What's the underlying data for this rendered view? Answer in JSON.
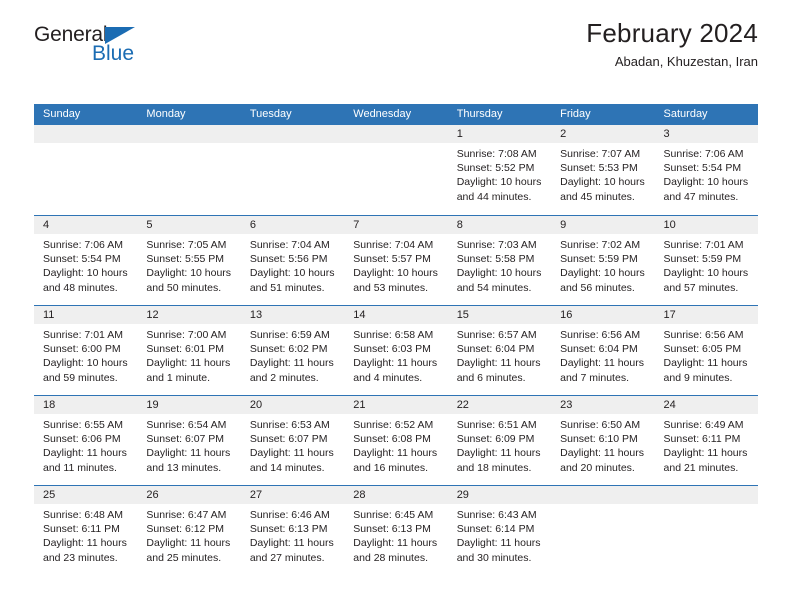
{
  "logo": {
    "text_top": "General",
    "text_bottom": "Blue",
    "triangle_color": "#1b6cb3"
  },
  "header": {
    "title": "February 2024",
    "subtitle": "Abadan, Khuzestan, Iran"
  },
  "colors": {
    "header_bar": "#2e74b5",
    "date_band": "#efefef",
    "text": "#231f20"
  },
  "weekdays": [
    "Sunday",
    "Monday",
    "Tuesday",
    "Wednesday",
    "Thursday",
    "Friday",
    "Saturday"
  ],
  "weeks": [
    [
      {
        "empty": true
      },
      {
        "empty": true
      },
      {
        "empty": true
      },
      {
        "empty": true
      },
      {
        "day": "1",
        "sunrise": "Sunrise: 7:08 AM",
        "sunset": "Sunset: 5:52 PM",
        "daylight1": "Daylight: 10 hours",
        "daylight2": "and 44 minutes."
      },
      {
        "day": "2",
        "sunrise": "Sunrise: 7:07 AM",
        "sunset": "Sunset: 5:53 PM",
        "daylight1": "Daylight: 10 hours",
        "daylight2": "and 45 minutes."
      },
      {
        "day": "3",
        "sunrise": "Sunrise: 7:06 AM",
        "sunset": "Sunset: 5:54 PM",
        "daylight1": "Daylight: 10 hours",
        "daylight2": "and 47 minutes."
      }
    ],
    [
      {
        "day": "4",
        "sunrise": "Sunrise: 7:06 AM",
        "sunset": "Sunset: 5:54 PM",
        "daylight1": "Daylight: 10 hours",
        "daylight2": "and 48 minutes."
      },
      {
        "day": "5",
        "sunrise": "Sunrise: 7:05 AM",
        "sunset": "Sunset: 5:55 PM",
        "daylight1": "Daylight: 10 hours",
        "daylight2": "and 50 minutes."
      },
      {
        "day": "6",
        "sunrise": "Sunrise: 7:04 AM",
        "sunset": "Sunset: 5:56 PM",
        "daylight1": "Daylight: 10 hours",
        "daylight2": "and 51 minutes."
      },
      {
        "day": "7",
        "sunrise": "Sunrise: 7:04 AM",
        "sunset": "Sunset: 5:57 PM",
        "daylight1": "Daylight: 10 hours",
        "daylight2": "and 53 minutes."
      },
      {
        "day": "8",
        "sunrise": "Sunrise: 7:03 AM",
        "sunset": "Sunset: 5:58 PM",
        "daylight1": "Daylight: 10 hours",
        "daylight2": "and 54 minutes."
      },
      {
        "day": "9",
        "sunrise": "Sunrise: 7:02 AM",
        "sunset": "Sunset: 5:59 PM",
        "daylight1": "Daylight: 10 hours",
        "daylight2": "and 56 minutes."
      },
      {
        "day": "10",
        "sunrise": "Sunrise: 7:01 AM",
        "sunset": "Sunset: 5:59 PM",
        "daylight1": "Daylight: 10 hours",
        "daylight2": "and 57 minutes."
      }
    ],
    [
      {
        "day": "11",
        "sunrise": "Sunrise: 7:01 AM",
        "sunset": "Sunset: 6:00 PM",
        "daylight1": "Daylight: 10 hours",
        "daylight2": "and 59 minutes."
      },
      {
        "day": "12",
        "sunrise": "Sunrise: 7:00 AM",
        "sunset": "Sunset: 6:01 PM",
        "daylight1": "Daylight: 11 hours",
        "daylight2": "and 1 minute."
      },
      {
        "day": "13",
        "sunrise": "Sunrise: 6:59 AM",
        "sunset": "Sunset: 6:02 PM",
        "daylight1": "Daylight: 11 hours",
        "daylight2": "and 2 minutes."
      },
      {
        "day": "14",
        "sunrise": "Sunrise: 6:58 AM",
        "sunset": "Sunset: 6:03 PM",
        "daylight1": "Daylight: 11 hours",
        "daylight2": "and 4 minutes."
      },
      {
        "day": "15",
        "sunrise": "Sunrise: 6:57 AM",
        "sunset": "Sunset: 6:04 PM",
        "daylight1": "Daylight: 11 hours",
        "daylight2": "and 6 minutes."
      },
      {
        "day": "16",
        "sunrise": "Sunrise: 6:56 AM",
        "sunset": "Sunset: 6:04 PM",
        "daylight1": "Daylight: 11 hours",
        "daylight2": "and 7 minutes."
      },
      {
        "day": "17",
        "sunrise": "Sunrise: 6:56 AM",
        "sunset": "Sunset: 6:05 PM",
        "daylight1": "Daylight: 11 hours",
        "daylight2": "and 9 minutes."
      }
    ],
    [
      {
        "day": "18",
        "sunrise": "Sunrise: 6:55 AM",
        "sunset": "Sunset: 6:06 PM",
        "daylight1": "Daylight: 11 hours",
        "daylight2": "and 11 minutes."
      },
      {
        "day": "19",
        "sunrise": "Sunrise: 6:54 AM",
        "sunset": "Sunset: 6:07 PM",
        "daylight1": "Daylight: 11 hours",
        "daylight2": "and 13 minutes."
      },
      {
        "day": "20",
        "sunrise": "Sunrise: 6:53 AM",
        "sunset": "Sunset: 6:07 PM",
        "daylight1": "Daylight: 11 hours",
        "daylight2": "and 14 minutes."
      },
      {
        "day": "21",
        "sunrise": "Sunrise: 6:52 AM",
        "sunset": "Sunset: 6:08 PM",
        "daylight1": "Daylight: 11 hours",
        "daylight2": "and 16 minutes."
      },
      {
        "day": "22",
        "sunrise": "Sunrise: 6:51 AM",
        "sunset": "Sunset: 6:09 PM",
        "daylight1": "Daylight: 11 hours",
        "daylight2": "and 18 minutes."
      },
      {
        "day": "23",
        "sunrise": "Sunrise: 6:50 AM",
        "sunset": "Sunset: 6:10 PM",
        "daylight1": "Daylight: 11 hours",
        "daylight2": "and 20 minutes."
      },
      {
        "day": "24",
        "sunrise": "Sunrise: 6:49 AM",
        "sunset": "Sunset: 6:11 PM",
        "daylight1": "Daylight: 11 hours",
        "daylight2": "and 21 minutes."
      }
    ],
    [
      {
        "day": "25",
        "sunrise": "Sunrise: 6:48 AM",
        "sunset": "Sunset: 6:11 PM",
        "daylight1": "Daylight: 11 hours",
        "daylight2": "and 23 minutes."
      },
      {
        "day": "26",
        "sunrise": "Sunrise: 6:47 AM",
        "sunset": "Sunset: 6:12 PM",
        "daylight1": "Daylight: 11 hours",
        "daylight2": "and 25 minutes."
      },
      {
        "day": "27",
        "sunrise": "Sunrise: 6:46 AM",
        "sunset": "Sunset: 6:13 PM",
        "daylight1": "Daylight: 11 hours",
        "daylight2": "and 27 minutes."
      },
      {
        "day": "28",
        "sunrise": "Sunrise: 6:45 AM",
        "sunset": "Sunset: 6:13 PM",
        "daylight1": "Daylight: 11 hours",
        "daylight2": "and 28 minutes."
      },
      {
        "day": "29",
        "sunrise": "Sunrise: 6:43 AM",
        "sunset": "Sunset: 6:14 PM",
        "daylight1": "Daylight: 11 hours",
        "daylight2": "and 30 minutes."
      },
      {
        "empty": true
      },
      {
        "empty": true
      }
    ]
  ]
}
